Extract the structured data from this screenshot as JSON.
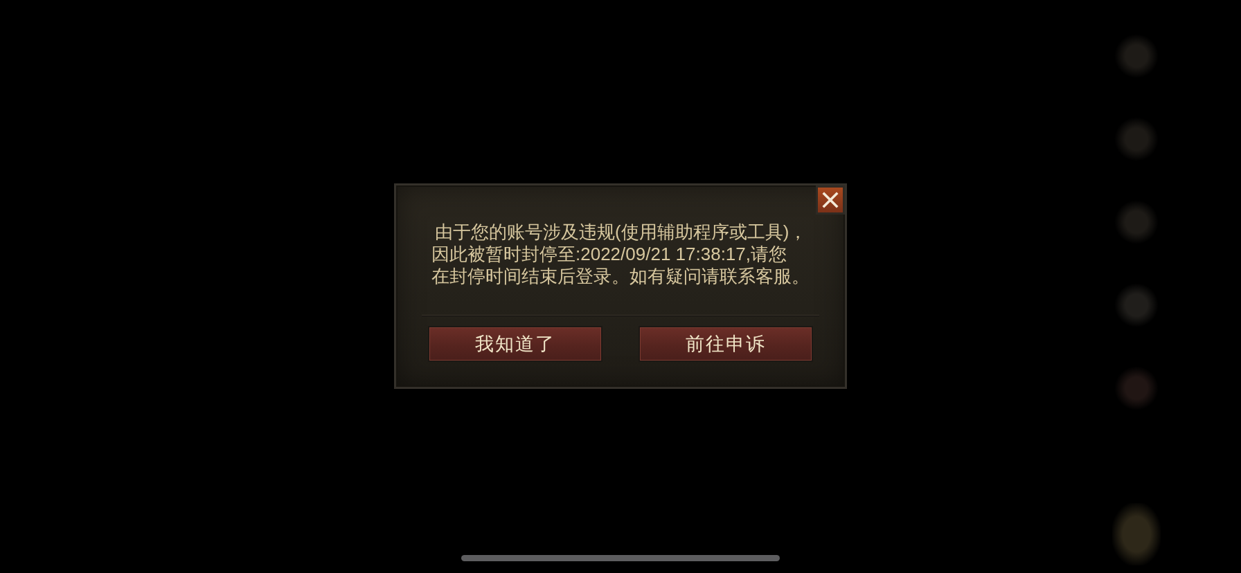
{
  "dialog": {
    "message_lines": [
      "由于您的账号涉及违规(使用辅助程序或工具)，",
      "因此被暂时封停至:2022/09/21 17:38:17,请您",
      "在封停时间结束后登录。如有疑问请联系客服。"
    ],
    "buttons": [
      {
        "label": "我知道了"
      },
      {
        "label": "前往申诉"
      }
    ]
  }
}
